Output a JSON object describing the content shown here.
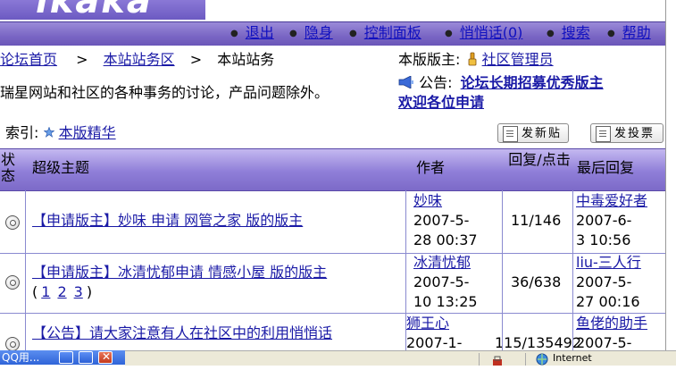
{
  "header": {
    "logo_text": "ikaka",
    "nav": [
      {
        "label": "退出"
      },
      {
        "label": "隐身"
      },
      {
        "label": "控制面板"
      },
      {
        "label": "悄悄话(0)"
      },
      {
        "label": "搜索"
      },
      {
        "label": "帮助"
      }
    ]
  },
  "breadcrumb": {
    "home": "论坛首页",
    "sep": ">",
    "area": "本站站务区",
    "current": "本站站务"
  },
  "moderator": {
    "label": "本版版主:",
    "name": "社区管理员"
  },
  "forum_desc": "瑞星网站和社区的各种事务的讨论，产品问题除外。",
  "announcement": {
    "label": "公告:",
    "text_line1": "论坛长期招募优秀版主",
    "text_line2": "欢迎各位申请"
  },
  "index": {
    "label": "索引:",
    "link": "本版精华"
  },
  "buttons": {
    "new_post": "发新贴",
    "new_poll": "发投票"
  },
  "table": {
    "headers": {
      "status": "状态",
      "topic": "超级主题",
      "author": "作者",
      "replies": "回复/点击",
      "last": "最后回复"
    },
    "rows": [
      {
        "topic": "【申请版主】妙味 申请 网管之家 版的版主",
        "pages": [],
        "author": "妙味",
        "date1": "2007-5-",
        "date2": "28 00:37",
        "replies": "11/146",
        "last_user": "中毒爱好者",
        "last1": "2007-6-",
        "last2": "3 10:56"
      },
      {
        "topic": "【申请版主】冰清忧郁申请 情感小屋 版的版主",
        "pages_prefix": "(",
        "pages": [
          "1",
          "2",
          "3"
        ],
        "pages_suffix": ")",
        "author": "冰清忧郁",
        "date1": "2007-5-",
        "date2": "10 13:25",
        "replies": "36/638",
        "last_user": "liu-三人行",
        "last1": "2007-5-",
        "last2": "27 00:16"
      },
      {
        "topic": "【公告】请大家注意有人在社区中的利用悄悄话",
        "pages": [],
        "author": "狮王心",
        "date1": "2007-1-",
        "replies": "115/135492",
        "last_user": "鱼佬的助手",
        "last1": "2007-5-"
      }
    ]
  },
  "taskbar": {
    "task_label": "QQ用...",
    "status_zone": "Internet"
  }
}
